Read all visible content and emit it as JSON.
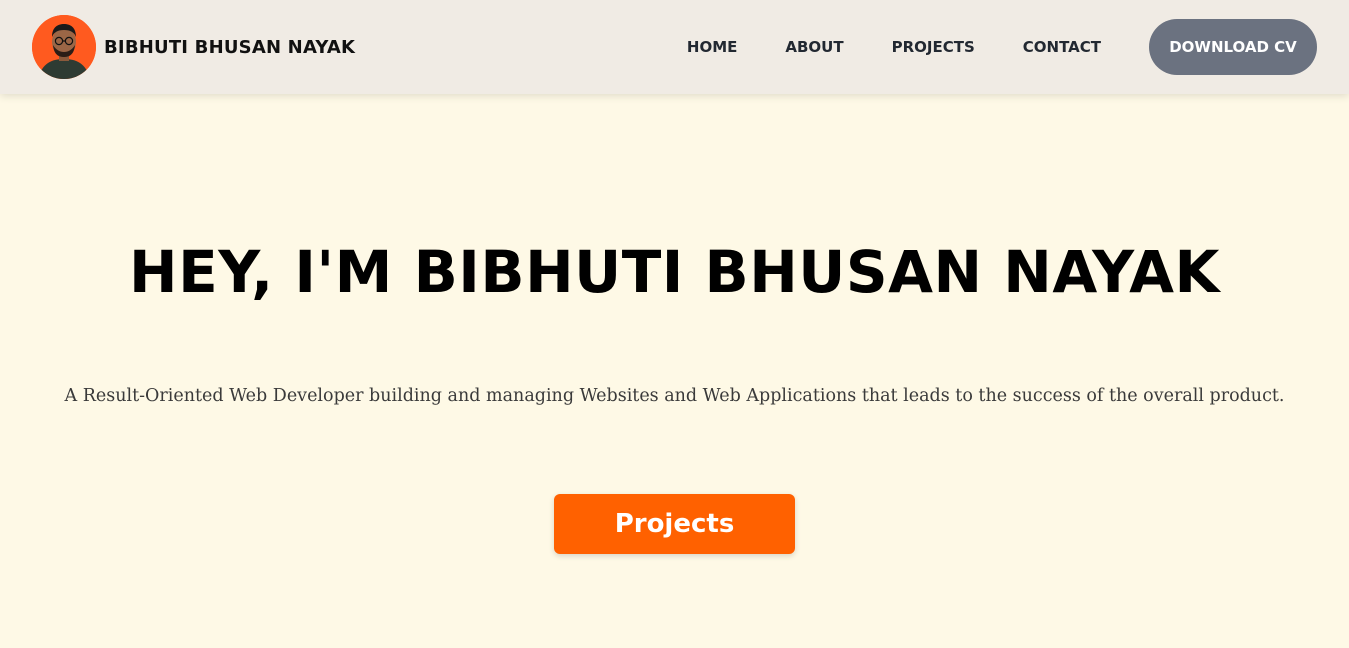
{
  "header": {
    "avatar_icon": "person-avatar",
    "brand_name": "BIBHUTI BHUSAN NAYAK",
    "nav": [
      {
        "label": "HOME"
      },
      {
        "label": "ABOUT"
      },
      {
        "label": "PROJECTS"
      },
      {
        "label": "CONTACT"
      }
    ],
    "cv_button_label": "DOWNLOAD CV"
  },
  "hero": {
    "title": "HEY, I'M BIBHUTI BHUSAN NAYAK",
    "subtitle": "A Result-Oriented Web Developer building and managing Websites and Web Applications that leads to the success of the overall product.",
    "cta_label": "Projects"
  },
  "colors": {
    "page_background": "#fef9e6",
    "header_background": "#f0ebe4",
    "avatar_background": "#ff5a1f",
    "cv_button": "#6b7280",
    "cta_button": "#ff6100"
  }
}
